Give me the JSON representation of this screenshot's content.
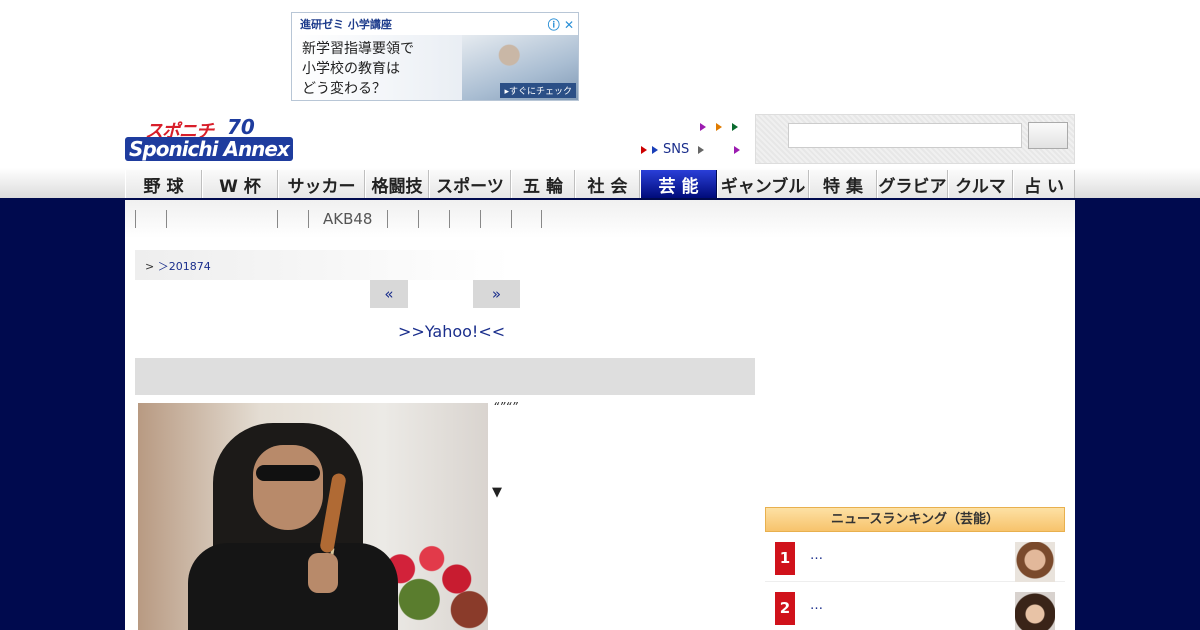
{
  "ad": {
    "brand": "進研ゼミ 小学講座",
    "line1": "新学習指導要領で",
    "line2": "小学校の教育は",
    "line3": "どう変わる？",
    "cta": "▸すぐにチェック",
    "controls": "ⓘ ✕"
  },
  "header": {
    "logo_top": "スポニチ",
    "logo_bottom": "Sponichi Annex",
    "logo_mark": "70",
    "sns_label": "SNS",
    "search_placeholder": ""
  },
  "nav": {
    "items": [
      {
        "label": "野 球"
      },
      {
        "label": "W 杯"
      },
      {
        "label": "サッカー"
      },
      {
        "label": "格闘技"
      },
      {
        "label": "スポーツ"
      },
      {
        "label": "五 輪"
      },
      {
        "label": "社 会"
      },
      {
        "label": "芸 能",
        "active": true
      },
      {
        "label": "ギャンブル"
      },
      {
        "label": "特 集"
      },
      {
        "label": "グラビア"
      },
      {
        "label": "クルマ"
      },
      {
        "label": "占 い"
      }
    ]
  },
  "subnav": {
    "akb": "AKB48"
  },
  "article": {
    "breadcrumb_sep": ">",
    "breadcrumb_link": "＞201874",
    "prev": "«",
    "next": "»",
    "yahoo": ">>Yahoo!<<",
    "quote": "“”“”",
    "arrow": "▼"
  },
  "ranking": {
    "title": "ニュースランキング（芸能）",
    "items": [
      {
        "rank": "1",
        "text": "…"
      },
      {
        "rank": "2",
        "text": "…"
      }
    ]
  },
  "colors": {
    "navy": "#000a4e",
    "active_tab": "#000b7a",
    "rank_red": "#d0121b",
    "link": "#1a2e8c"
  }
}
